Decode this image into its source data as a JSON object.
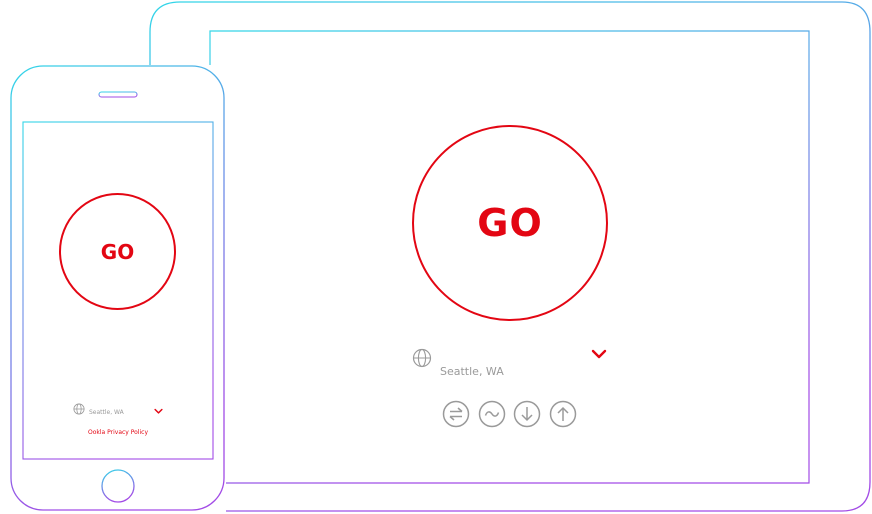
{
  "tablet": {
    "go_label": "GO",
    "location": "Seattle, WA",
    "icons": [
      "multi-server-icon",
      "single-connection-icon",
      "download-icon",
      "upload-icon"
    ]
  },
  "phone": {
    "go_label": "GO",
    "location": "Seattle, WA",
    "privacy_link": "Ookla Privacy Policy"
  },
  "colors": {
    "accent": "#e30613",
    "frame_gradient_start": "#33d6e8",
    "frame_gradient_end": "#a24be6",
    "muted": "#9a9a9a"
  }
}
